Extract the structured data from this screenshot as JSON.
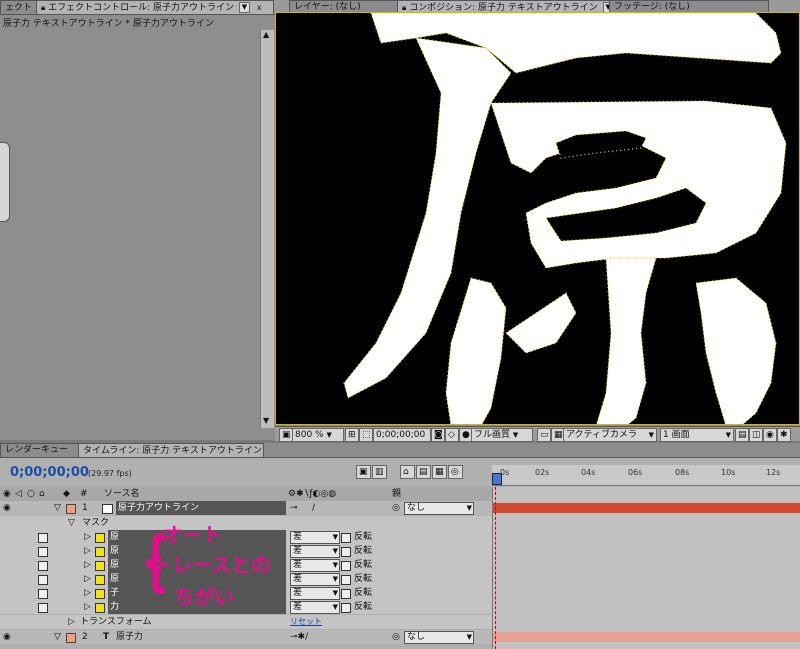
{
  "left_panel": {
    "tabs": [
      {
        "label": "ェクト",
        "menu": "▼",
        "close": "x"
      },
      {
        "label": "エフェクトコントロール: 原子力アウトライン",
        "menu": "▼",
        "close": "x"
      }
    ],
    "breadcrumb": "原子力 テキストアウトライン * 原子力アウトライン"
  },
  "viewer": {
    "tabs": [
      {
        "label": "レイヤー: (なし)"
      },
      {
        "label": "コンポジション: 原子力 テキストアウトライン",
        "menu": "▼",
        "close": "x"
      },
      {
        "label": "フッテージ: (なし)"
      }
    ],
    "toolbar": {
      "zoom": "800 %",
      "timecode": "0;00;00;00",
      "resolution": "フル画質",
      "camera": "アクティブカメラ",
      "views": "1 画面"
    }
  },
  "timeline": {
    "tabs": [
      {
        "label": "レンダーキュー"
      },
      {
        "label": "タイムライン: 原子力 テキストアウトライン",
        "close": "x"
      }
    ],
    "timecode": "0;00;00;00",
    "fps": "(29.97 fps)",
    "header": {
      "num": "#",
      "source": "ソース名",
      "parent": "親"
    },
    "ruler": [
      "0s",
      "02s",
      "04s",
      "06s",
      "08s",
      "10s",
      "12s"
    ],
    "layers": [
      {
        "num": "1",
        "name": "原子力アウトライン",
        "parent": "なし",
        "color": "#f0a080"
      },
      {
        "num": "2",
        "name": "原子力",
        "type": "T",
        "parent": "なし",
        "color": "#f0a080"
      }
    ],
    "mask_group": "マスク",
    "masks": [
      {
        "name": "原",
        "mode": "差",
        "invert": "反転"
      },
      {
        "name": "原",
        "mode": "差",
        "invert": "反転"
      },
      {
        "name": "原",
        "mode": "差",
        "invert": "反転"
      },
      {
        "name": "原",
        "mode": "差",
        "invert": "反転"
      },
      {
        "name": "子",
        "mode": "差",
        "invert": "反転"
      },
      {
        "name": "力",
        "mode": "差",
        "invert": "反転"
      }
    ],
    "transform": {
      "label": "トランスフォーム",
      "reset": "リセット"
    }
  },
  "annotation": {
    "lines": [
      "オート",
      "トレースとの",
      "ちがい"
    ],
    "color": "#e0108a"
  }
}
